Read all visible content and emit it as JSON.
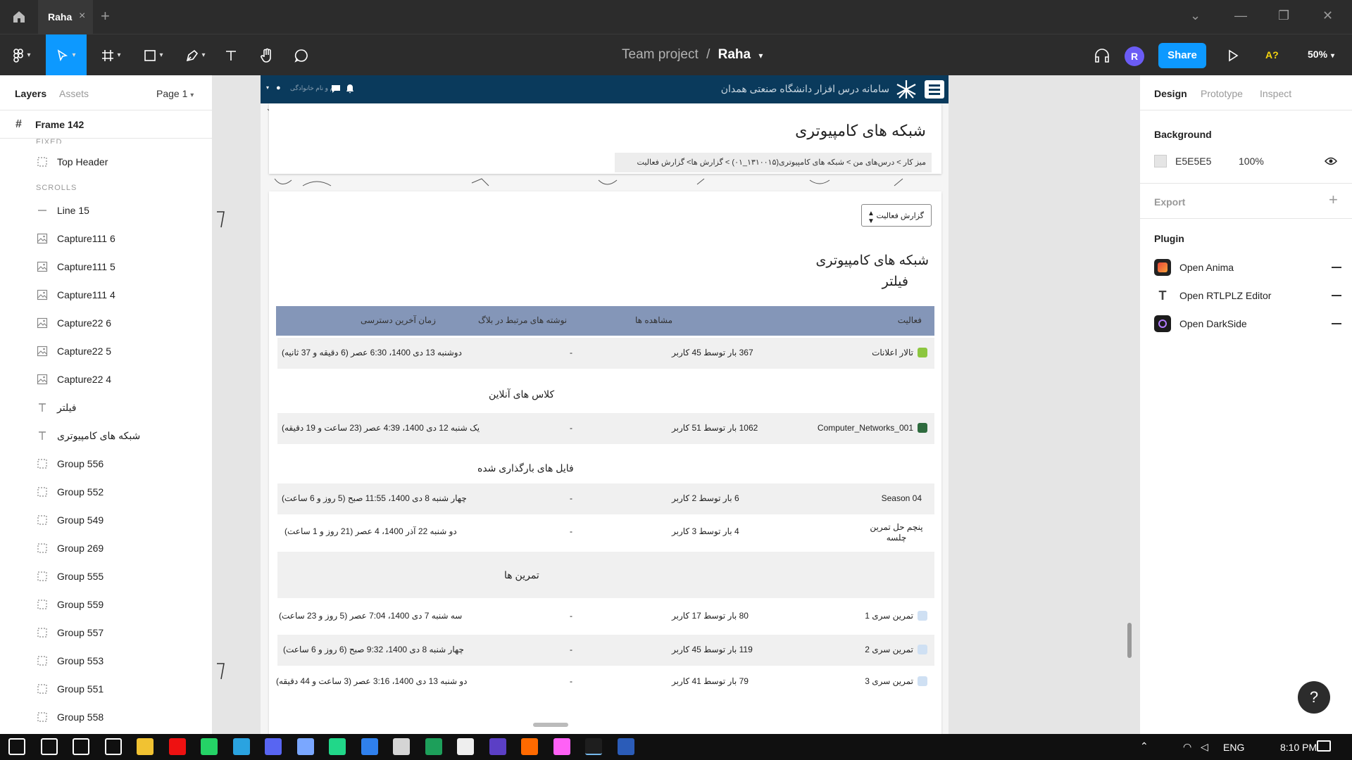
{
  "window": {
    "tab_label": "Raha",
    "tab_close": "×",
    "tab_add": "+",
    "controls": [
      "⌄",
      "—",
      "❐",
      "✕"
    ]
  },
  "toolbar": {
    "tools": [
      "main-menu-icon",
      "move-icon",
      "frame-icon",
      "shape-icon",
      "pen-icon",
      "text-icon",
      "hand-icon",
      "comment-icon"
    ],
    "project": "Team project",
    "separator": "/",
    "file": "Raha",
    "avatar_initial": "R",
    "share_label": "Share",
    "accessibility_label": "A?",
    "zoom": "50%"
  },
  "left_panel": {
    "tabs": {
      "layers": "Layers",
      "assets": "Assets",
      "page": "Page 1"
    },
    "frame": "Frame 142",
    "fixed_label": "FIXED",
    "scrolls_label": "SCROLLS",
    "fixed_layers": [
      {
        "name": "Top Header",
        "icon": "group-icon"
      }
    ],
    "layers": [
      {
        "name": "Line 15",
        "icon": "line-icon"
      },
      {
        "name": "Capture111 6",
        "icon": "image-icon"
      },
      {
        "name": "Capture111 5",
        "icon": "image-icon"
      },
      {
        "name": "Capture111 4",
        "icon": "image-icon"
      },
      {
        "name": "Capture22 6",
        "icon": "image-icon"
      },
      {
        "name": "Capture22 5",
        "icon": "image-icon"
      },
      {
        "name": "Capture22 4",
        "icon": "image-icon"
      },
      {
        "name": "فیلتر",
        "icon": "text-icon"
      },
      {
        "name": "شبکه های کامپیوتری",
        "icon": "text-icon"
      },
      {
        "name": "Group 556",
        "icon": "group-icon"
      },
      {
        "name": "Group 552",
        "icon": "group-icon"
      },
      {
        "name": "Group 549",
        "icon": "group-icon"
      },
      {
        "name": "Group 269",
        "icon": "group-icon"
      },
      {
        "name": "Group 555",
        "icon": "group-icon"
      },
      {
        "name": "Group 559",
        "icon": "group-icon"
      },
      {
        "name": "Group 557",
        "icon": "group-icon"
      },
      {
        "name": "Group 553",
        "icon": "group-icon"
      },
      {
        "name": "Group 551",
        "icon": "group-icon"
      },
      {
        "name": "Group 558",
        "icon": "group-icon"
      }
    ]
  },
  "right_panel": {
    "tabs": {
      "design": "Design",
      "prototype": "Prototype",
      "inspect": "Inspect"
    },
    "background": {
      "title": "Background",
      "hex": "E5E5E5",
      "opacity": "100%",
      "swatch": "#E5E5E5"
    },
    "export": {
      "title": "Export",
      "add": "+"
    },
    "plugin": {
      "title": "Plugin",
      "items": [
        {
          "name": "Open Anima",
          "color": "#e8463a"
        },
        {
          "name": "Open RTLPLZ Editor",
          "color": "#ffffff"
        },
        {
          "name": "Open DarkSide",
          "color": "#1c1c1c"
        }
      ]
    },
    "help": "?"
  },
  "site": {
    "header_title": "سامانه درس افزار دانشگاه صنعتی همدان",
    "user_label": "نام و نام خانوادگی",
    "course_title": "شبکه های کامپیوتری",
    "breadcrumb": "میز کار > درس‌های من > شبکه های کامپیوتری(۱۳۱۰۰۱۵_۰۱) > گزارش ها> گزارش فعالیت",
    "report_select": "گزارش فعالیت",
    "main_heading": "شبکه های کامپیوتری",
    "filter_label": "فیلتر",
    "table_headers": {
      "activity": "فعالیت",
      "views": "مشاهده ها",
      "blog": "نوشته های مرتبط در بلاگ",
      "last_access": "زمان آخرین دسترسی"
    },
    "rows": {
      "r1": {
        "activity": "تالار اعلانات",
        "views": "367 بار توسط 45 کاربر",
        "blog": "-",
        "last": "دوشنبه 13 دی 1400، 6:30 عصر (6 دقیقه و 37 ثانیه)"
      },
      "r2": {
        "activity": "Computer_Networks_001",
        "views": "1062 بار توسط 51 کاربر",
        "blog": "-",
        "last": "یک شنبه 12 دی 1400، 4:39 عصر (23 ساعت و 19 دقیقه)"
      },
      "r3": {
        "activity": "Season 04",
        "views": "6 بار توسط 2 کاربر",
        "blog": "-",
        "last": "چهار شنبه 8 دی 1400، 11:55 صبح (5 روز و 6 ساعت)"
      },
      "r4": {
        "activity": "پنچم حل تمرین چلسه",
        "views": "4 بار توسط 3 کاربر",
        "blog": "-",
        "last": "دو شنبه 22 آذر 1400، 4 عصر (21 روز و 1 ساعت)"
      },
      "r5": {
        "activity": "تمرین سری 1",
        "views": "80 بار توسط 17 کاربر",
        "blog": "-",
        "last": "سه شنبه 7 دی 1400، 7:04 عصر (5 روز و 23 ساعت)"
      },
      "r6": {
        "activity": "تمرین سری 2",
        "views": "119 بار توسط 45 کاربر",
        "blog": "-",
        "last": "چهار شنبه 8 دی 1400، 9:32 صبح (6 روز و 6 ساعت)"
      },
      "r7": {
        "activity": "تمرین سری 3",
        "views": "79 بار توسط 41 کاربر",
        "blog": "-",
        "last": "دو شنبه 13 دی 1400، 3:16 عصر (3 ساعت و 44 دقیقه)"
      }
    },
    "sections": {
      "online_classes": "کلاس های آنلاین",
      "uploaded_files": "فایل های بارگذاری شده",
      "exercises": "تمرین ها"
    }
  },
  "taskbar": {
    "apps": [
      "windows-start-icon",
      "search-icon",
      "cortana-icon",
      "task-view-icon",
      "file-explorer-icon",
      "opera-icon",
      "whatsapp-icon",
      "telegram-icon",
      "discord-icon",
      "box-icon",
      "pycharm-icon",
      "vscode-icon",
      "xampp-icon",
      "excel-icon",
      "app-icon",
      "wps-icon",
      "app-icon",
      "xd-icon",
      "figma-icon",
      "word-icon"
    ],
    "tray": "ENG",
    "clock": "8:10 PM"
  }
}
